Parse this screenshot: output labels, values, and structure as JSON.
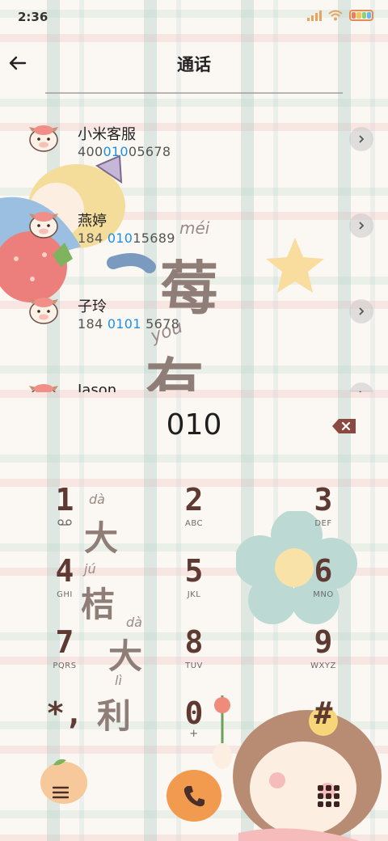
{
  "status_bar": {
    "time": "2:36"
  },
  "header": {
    "title": "通话"
  },
  "contacts": [
    {
      "name": "小米客服",
      "number_parts": [
        "400",
        "010",
        "05678"
      ],
      "avatar_icon": "cow-avatar-icon"
    },
    {
      "name": "燕婷",
      "number_parts": [
        "184 ",
        "010",
        "15689"
      ],
      "avatar_icon": "cow-avatar-icon"
    },
    {
      "name": "子玲",
      "number_parts": [
        "184 ",
        "0101",
        " 5678"
      ],
      "avatar_icon": "cow-avatar-icon"
    },
    {
      "name": "Jason",
      "number_parts": [
        "",
        "",
        ""
      ],
      "avatar_icon": "cow-avatar-icon"
    }
  ],
  "dial": {
    "input": "010"
  },
  "keypad": [
    {
      "digit": "1",
      "letters": "ꝏ"
    },
    {
      "digit": "2",
      "letters": "ABC"
    },
    {
      "digit": "3",
      "letters": "DEF"
    },
    {
      "digit": "4",
      "letters": "GHI"
    },
    {
      "digit": "5",
      "letters": "JKL"
    },
    {
      "digit": "6",
      "letters": "MNO"
    },
    {
      "digit": "7",
      "letters": "PQRS"
    },
    {
      "digit": "8",
      "letters": "TUV"
    },
    {
      "digit": "9",
      "letters": "WXYZ"
    },
    {
      "digit": "*,",
      "letters": ""
    },
    {
      "digit": "0",
      "letters": "+"
    },
    {
      "digit": "#",
      "letters": ""
    }
  ],
  "decorations": {
    "strawberry_char": "莓",
    "strawberry_pinyin": "méi",
    "you_char": "有",
    "you_pinyin": "you",
    "da_char": "大",
    "da_pinyin": "dà",
    "ju_char": "桔",
    "ju_pinyin": "jú",
    "da2_char": "大",
    "da2_pinyin": "dà",
    "li_char": "利",
    "li_pinyin": "lì"
  },
  "colors": {
    "highlight": "#1e8fe6",
    "key_digit": "#5e3a33",
    "call_button": "#f29a4e",
    "menu_button": "#f7c99a"
  }
}
